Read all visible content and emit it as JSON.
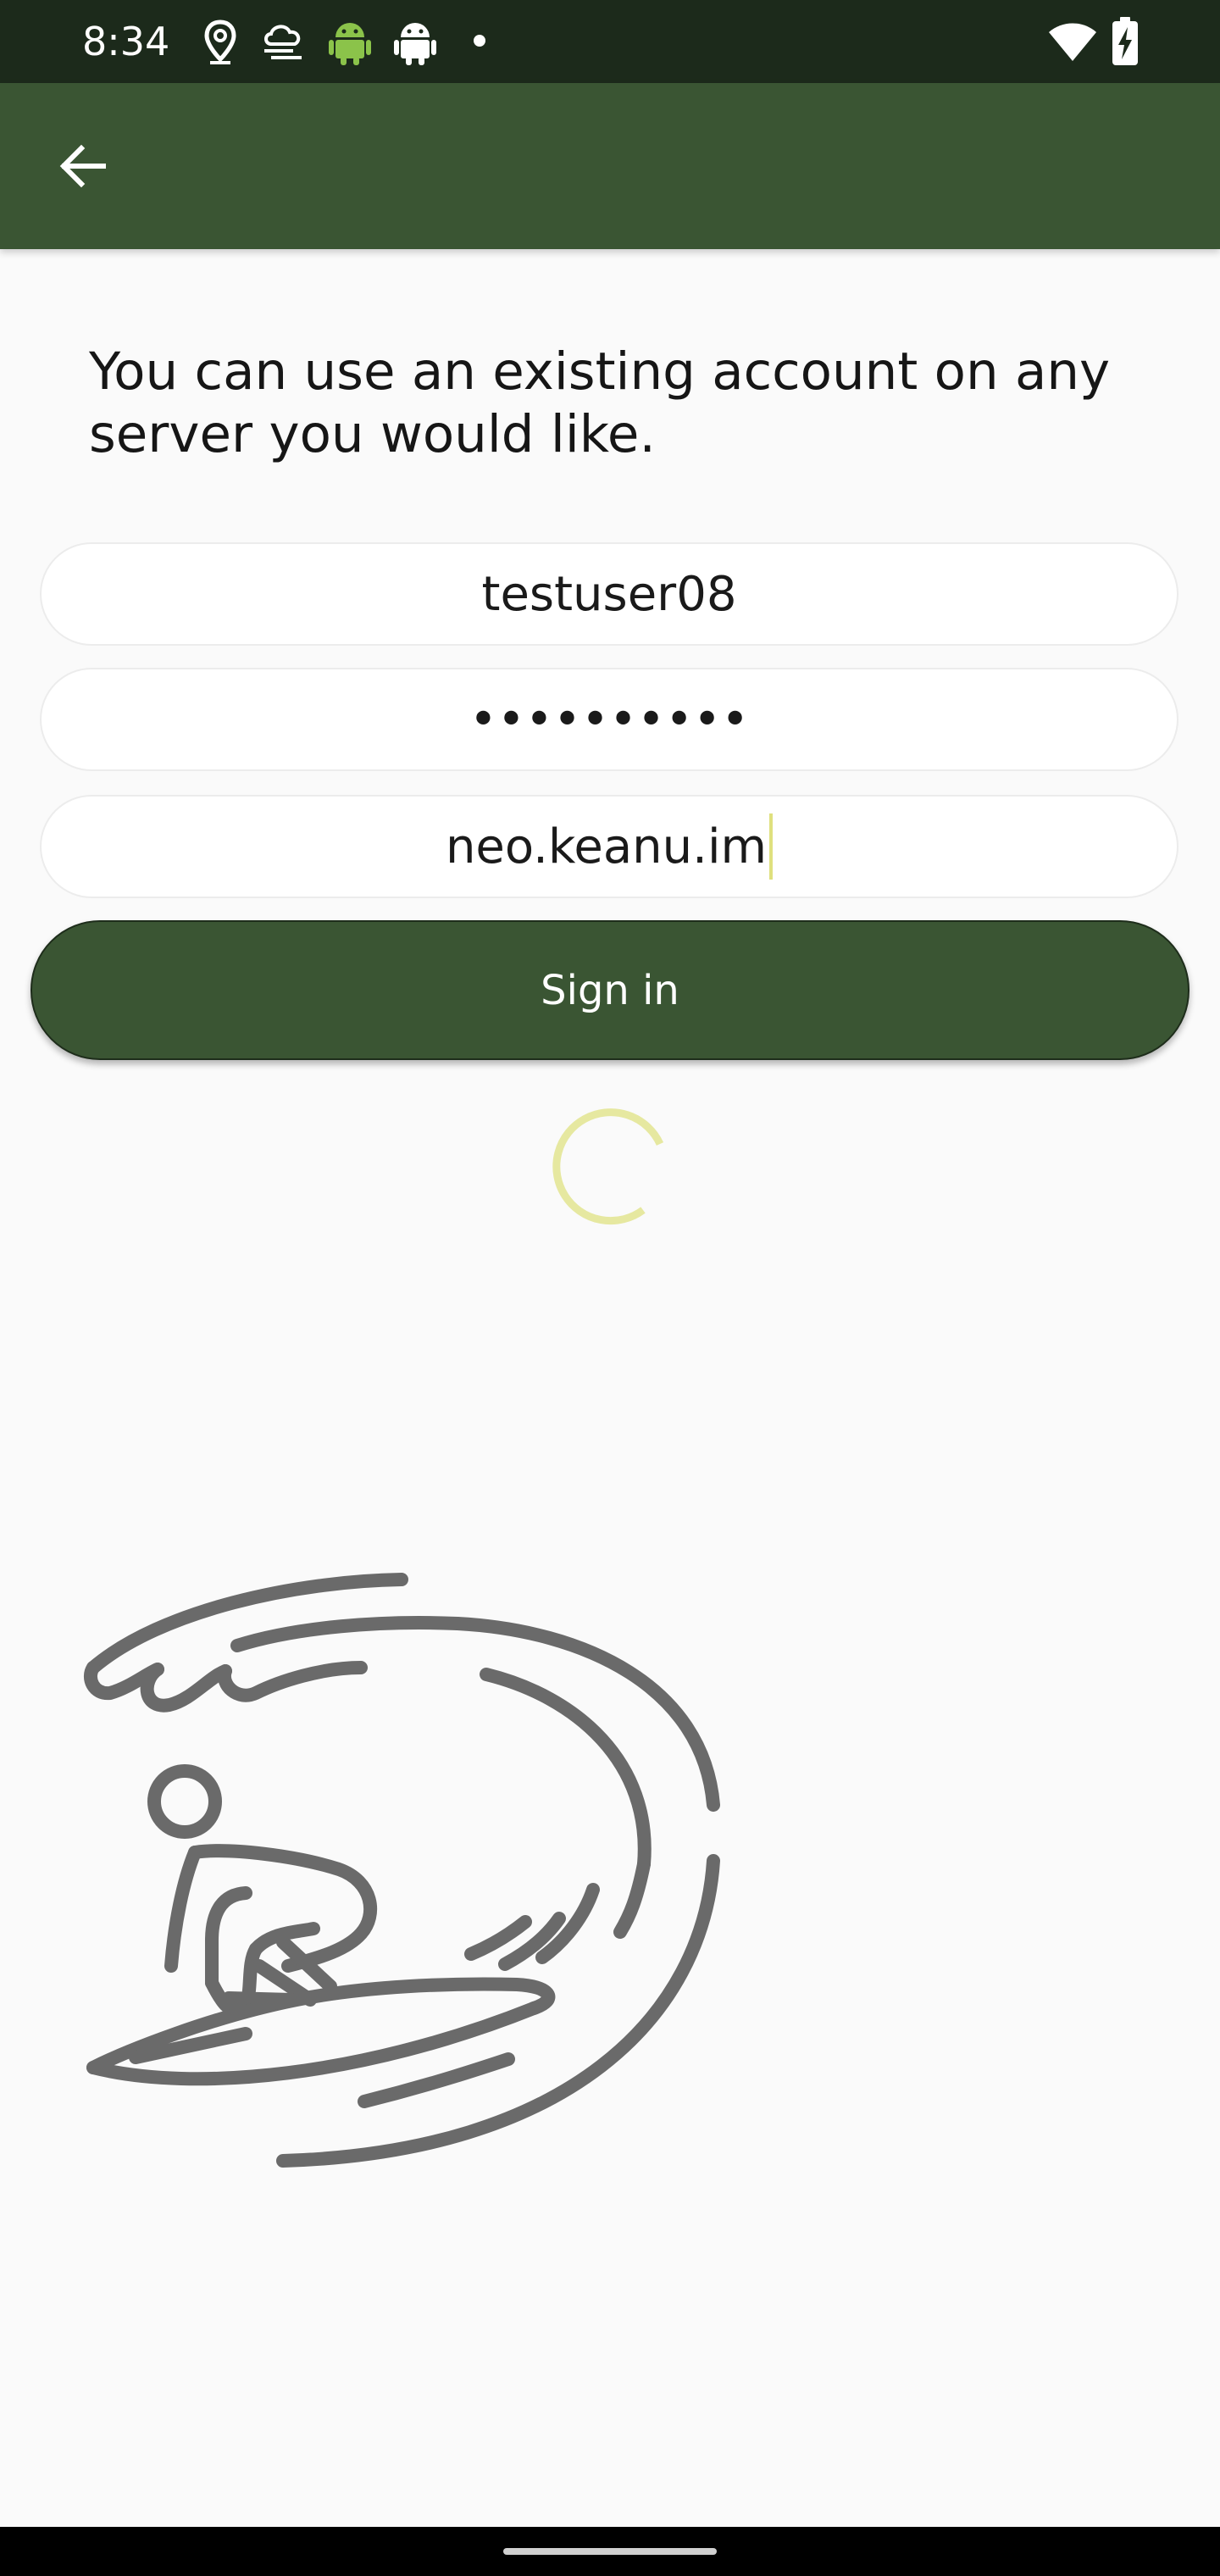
{
  "status_bar": {
    "time": "8:34",
    "icons": [
      "location-icon",
      "cloud-weather-icon",
      "android-icon",
      "android-debug-icon",
      "notification-dot-icon",
      "wifi-icon",
      "battery-charging-icon"
    ]
  },
  "app_bar": {
    "back_icon": "arrow-back-icon"
  },
  "login": {
    "intro_text": "You can use an existing account on any server you would like.",
    "username_value": "testuser08",
    "password_value": "••••••••••",
    "server_value": "neo.keanu.im",
    "signin_label": "Sign in"
  },
  "colors": {
    "primary": "#3a5533",
    "status_bar": "#1c2a1b",
    "spinner": "#e6e8a0",
    "illustration": "#6a6a6a",
    "background": "#fafafa"
  },
  "illustration": {
    "icon": "surfer-wave-icon"
  }
}
